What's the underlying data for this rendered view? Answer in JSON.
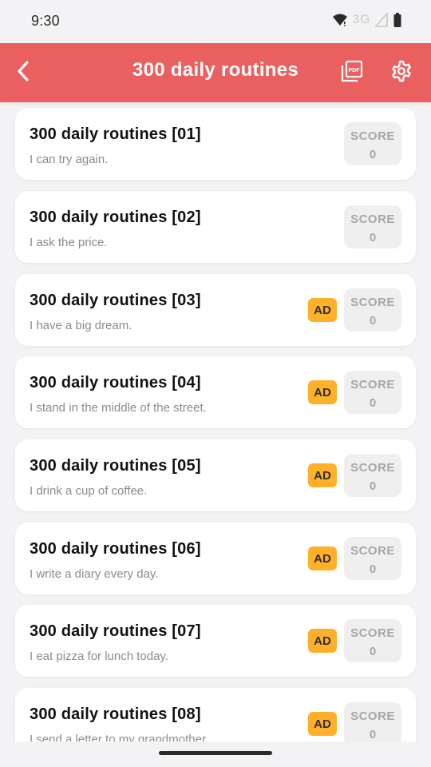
{
  "status_bar": {
    "time": "9:30",
    "network": "3G"
  },
  "app_bar": {
    "title": "300 daily routines",
    "icons": [
      "back-icon",
      "pdf-icon",
      "settings-icon"
    ],
    "color": "#ea5f5f"
  },
  "colors": {
    "ad_badge": "#ffb02a",
    "score_box": "#efefef",
    "score_text": "#a7a7a7",
    "subtitle": "#8b8b8b",
    "background": "#f3f3f5"
  },
  "lessons": [
    {
      "title": "300 daily routines [01]",
      "subtitle": "I can try again.",
      "ad": "",
      "score_label": "SCORE",
      "score": "0"
    },
    {
      "title": "300 daily routines [02]",
      "subtitle": "I ask the price.",
      "ad": "",
      "score_label": "SCORE",
      "score": "0"
    },
    {
      "title": "300 daily routines [03]",
      "subtitle": "I have a big dream.",
      "ad": "AD",
      "score_label": "SCORE",
      "score": "0"
    },
    {
      "title": "300 daily routines [04]",
      "subtitle": "I stand in the middle of the street.",
      "ad": "AD",
      "score_label": "SCORE",
      "score": "0"
    },
    {
      "title": "300 daily routines [05]",
      "subtitle": "I drink a cup of coffee.",
      "ad": "AD",
      "score_label": "SCORE",
      "score": "0"
    },
    {
      "title": "300 daily routines [06]",
      "subtitle": "I write a diary every day.",
      "ad": "AD",
      "score_label": "SCORE",
      "score": "0"
    },
    {
      "title": "300 daily routines [07]",
      "subtitle": "I eat pizza for lunch today.",
      "ad": "AD",
      "score_label": "SCORE",
      "score": "0"
    },
    {
      "title": "300 daily routines [08]",
      "subtitle": "I send a letter to my grandmother.",
      "ad": "AD",
      "score_label": "SCORE",
      "score": "0"
    }
  ]
}
